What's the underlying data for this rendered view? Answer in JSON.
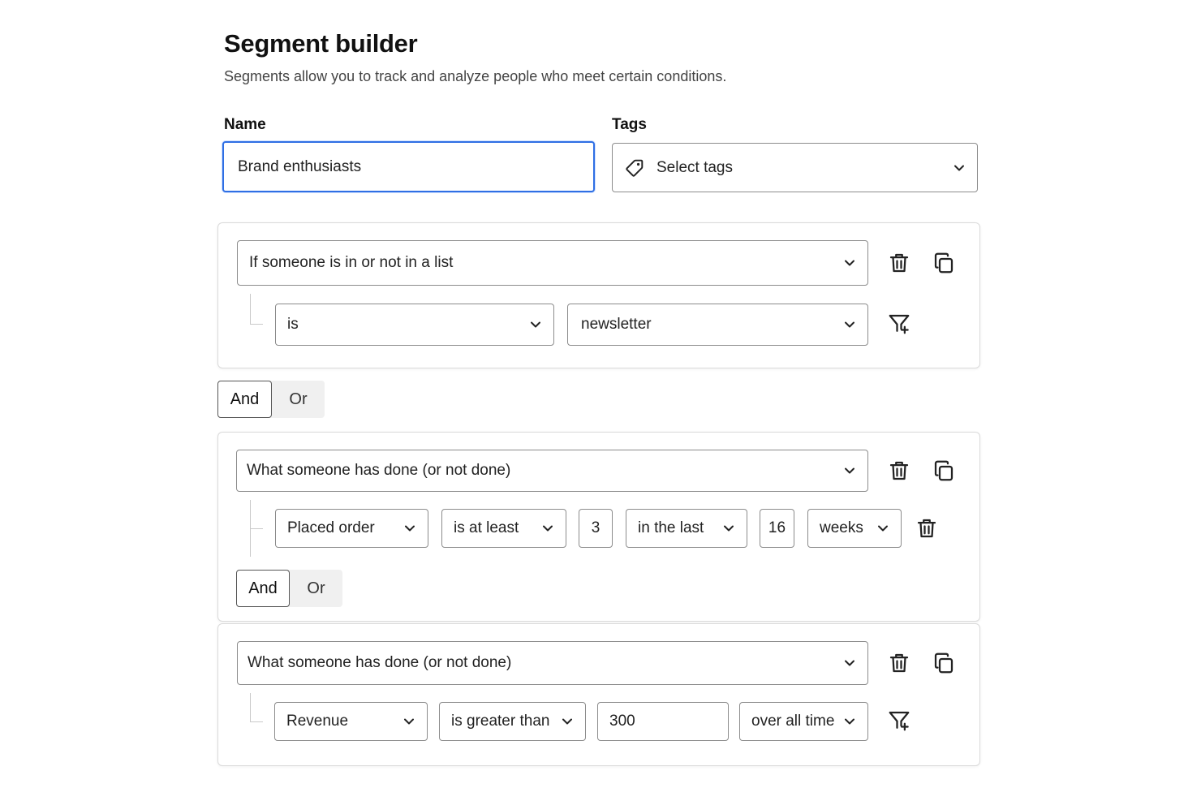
{
  "header": {
    "title": "Segment builder",
    "subtitle": "Segments allow you to track and analyze people who meet certain conditions."
  },
  "form": {
    "name_label": "Name",
    "name_value": "Brand enthusiasts",
    "tags_label": "Tags",
    "tags_placeholder": "Select tags"
  },
  "group1": {
    "condition": "If someone is in or not in a list",
    "operator": "is",
    "list": "newsletter"
  },
  "join1": {
    "and": "And",
    "or": "Or",
    "selected": "And"
  },
  "group2": {
    "condition": "What someone has done (or not done)",
    "event": "Placed order",
    "comparator": "is at least",
    "count": "3",
    "timeframe": "in the last",
    "period_value": "16",
    "period_unit": "weeks",
    "join": {
      "and": "And",
      "or": "Or",
      "selected": "And"
    }
  },
  "group3": {
    "condition": "What someone has done (or not done)",
    "metric": "Revenue",
    "comparator": "is greater than",
    "value": "300",
    "timeframe": "over all time"
  },
  "icons": {
    "delete": "trash-icon",
    "duplicate": "copy-icon",
    "filter": "filter-add-icon",
    "tag": "tag-icon",
    "dropdown": "chevron-down-icon"
  },
  "colors": {
    "focus_border": "#2f6fe4",
    "border": "#8c8c8c",
    "card_border": "#dadada",
    "toggle_bg": "#f0f0f0"
  }
}
